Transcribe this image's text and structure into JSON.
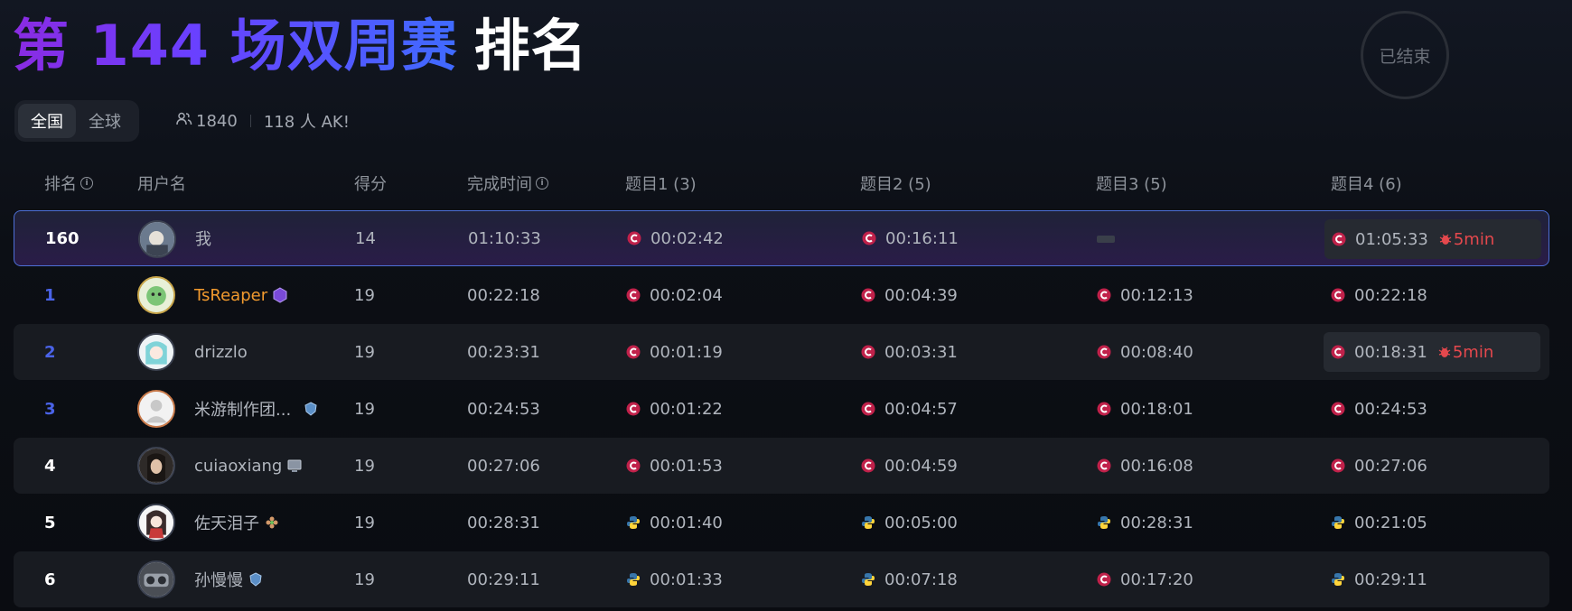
{
  "header": {
    "title_highlight": "第 144 场双周赛",
    "title_rest": "排名",
    "status": "已结束"
  },
  "scope_toggle": {
    "options": [
      "全国",
      "全球"
    ],
    "selected": "全国"
  },
  "stats": {
    "participants": "1840",
    "ak_text": "118 人 AK!"
  },
  "table": {
    "headers": {
      "rank": "排名",
      "username": "用户名",
      "score": "得分",
      "finish_time": "完成时间",
      "p1": "题目1 (3)",
      "p2": "题目2 (5)",
      "p3": "题目3 (5)",
      "p4": "题目4 (6)"
    },
    "rows": [
      {
        "rank": "160",
        "name": "我",
        "score": "14",
        "finish_time": "01:10:33",
        "p1": {
          "time": "00:02:42",
          "lang": "cpp"
        },
        "p2": {
          "time": "00:16:11",
          "lang": "cpp"
        },
        "p3": null,
        "p4": {
          "time": "01:05:33",
          "lang": "cpp",
          "penalty": "5min"
        }
      },
      {
        "rank": "1",
        "name": "TsReaper",
        "score": "19",
        "finish_time": "00:22:18",
        "p1": {
          "time": "00:02:04",
          "lang": "cpp"
        },
        "p2": {
          "time": "00:04:39",
          "lang": "cpp"
        },
        "p3": {
          "time": "00:12:13",
          "lang": "cpp"
        },
        "p4": {
          "time": "00:22:18",
          "lang": "cpp"
        }
      },
      {
        "rank": "2",
        "name": "drizzlo",
        "score": "19",
        "finish_time": "00:23:31",
        "p1": {
          "time": "00:01:19",
          "lang": "cpp"
        },
        "p2": {
          "time": "00:03:31",
          "lang": "cpp"
        },
        "p3": {
          "time": "00:08:40",
          "lang": "cpp"
        },
        "p4": {
          "time": "00:18:31",
          "lang": "cpp",
          "penalty": "5min"
        }
      },
      {
        "rank": "3",
        "name": "米游制作团...",
        "score": "19",
        "finish_time": "00:24:53",
        "p1": {
          "time": "00:01:22",
          "lang": "cpp"
        },
        "p2": {
          "time": "00:04:57",
          "lang": "cpp"
        },
        "p3": {
          "time": "00:18:01",
          "lang": "cpp"
        },
        "p4": {
          "time": "00:24:53",
          "lang": "cpp"
        }
      },
      {
        "rank": "4",
        "name": "cuiaoxiang",
        "score": "19",
        "finish_time": "00:27:06",
        "p1": {
          "time": "00:01:53",
          "lang": "cpp"
        },
        "p2": {
          "time": "00:04:59",
          "lang": "cpp"
        },
        "p3": {
          "time": "00:16:08",
          "lang": "cpp"
        },
        "p4": {
          "time": "00:27:06",
          "lang": "cpp"
        }
      },
      {
        "rank": "5",
        "name": "佐天泪子",
        "score": "19",
        "finish_time": "00:28:31",
        "p1": {
          "time": "00:01:40",
          "lang": "python"
        },
        "p2": {
          "time": "00:05:00",
          "lang": "python"
        },
        "p3": {
          "time": "00:28:31",
          "lang": "python"
        },
        "p4": {
          "time": "00:21:05",
          "lang": "python"
        }
      },
      {
        "rank": "6",
        "name": "孙慢慢",
        "score": "19",
        "finish_time": "00:29:11",
        "p1": {
          "time": "00:01:33",
          "lang": "python"
        },
        "p2": {
          "time": "00:07:18",
          "lang": "python"
        },
        "p3": {
          "time": "00:17:20",
          "lang": "cpp"
        },
        "p4": {
          "time": "00:29:11",
          "lang": "python"
        }
      }
    ]
  },
  "colors": {
    "title_gradient_start": "#8a2be2",
    "title_gradient_end": "#3f6bff",
    "rank_top3": "#4a63e8",
    "top_user_name": "#f29a2e",
    "penalty": "#e5484d",
    "current_user_border": "#4d6fd6"
  }
}
